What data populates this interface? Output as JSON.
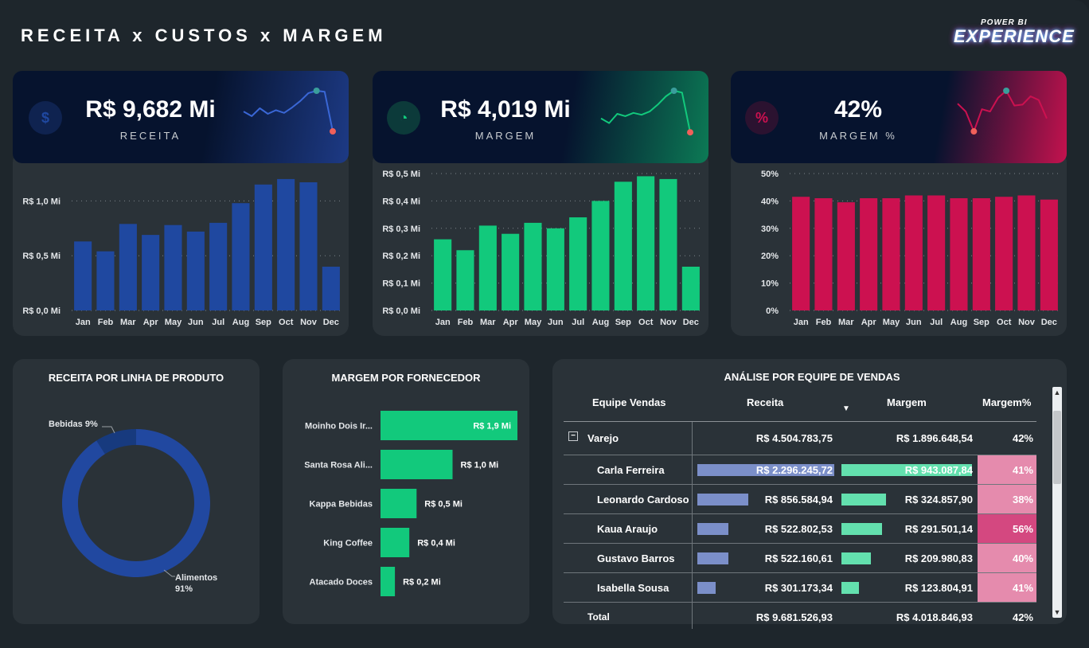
{
  "page": {
    "title": "RECEITA x CUSTOS x MARGEM",
    "logo_top": "POWER BI",
    "logo_main": "EXPERIENCE"
  },
  "colors": {
    "receita": "#1f48a0",
    "margem": "#12c97c",
    "margem_pct": "#cc1150",
    "table_receita_bar": "#7b8fc9",
    "table_margem_bar": "#63e0ae",
    "pct_light": "#e58bad",
    "pct_strong": "#d44880"
  },
  "kpis": [
    {
      "id": "receita",
      "value": "R$ 9,682 Mi",
      "label": "RECEITA",
      "icon": "money-bag-icon",
      "icon_glyph": "$",
      "line": [
        0.55,
        0.45,
        0.62,
        0.5,
        0.58,
        0.52,
        0.64,
        0.78,
        0.95,
        1.0,
        0.98,
        0.12
      ]
    },
    {
      "id": "margem",
      "value": "R$ 4,019 Mi",
      "label": "MARGEM",
      "icon": "pie-chart-icon",
      "icon_glyph": "◔",
      "line": [
        0.4,
        0.3,
        0.5,
        0.45,
        0.52,
        0.48,
        0.55,
        0.7,
        0.88,
        1.0,
        0.96,
        0.1
      ]
    },
    {
      "id": "margem_pct",
      "value": "42%",
      "label": "MARGEM %",
      "icon": "percent-icon",
      "icon_glyph": "%",
      "line": [
        0.72,
        0.55,
        0.12,
        0.6,
        0.55,
        0.85,
        1.0,
        0.68,
        0.7,
        0.88,
        0.8,
        0.4
      ]
    }
  ],
  "chart_data": [
    {
      "type": "bar",
      "title": "",
      "categories": [
        "Jan",
        "Feb",
        "Mar",
        "Apr",
        "May",
        "Jun",
        "Jul",
        "Aug",
        "Sep",
        "Oct",
        "Nov",
        "Dec"
      ],
      "values": [
        0.63,
        0.54,
        0.79,
        0.69,
        0.78,
        0.72,
        0.8,
        0.98,
        1.15,
        1.2,
        1.17,
        0.4
      ],
      "ylim": [
        0,
        1.25
      ],
      "yticks": [
        0,
        0.5,
        1.0
      ],
      "ytick_labels": [
        "R$ 0,0 Mi",
        "R$ 0,5 Mi",
        "R$ 1,0 Mi"
      ],
      "grid": true
    },
    {
      "type": "bar",
      "title": "",
      "categories": [
        "Jan",
        "Feb",
        "Mar",
        "Apr",
        "May",
        "Jun",
        "Jul",
        "Aug",
        "Sep",
        "Oct",
        "Nov",
        "Dec"
      ],
      "values": [
        0.26,
        0.22,
        0.31,
        0.28,
        0.32,
        0.3,
        0.34,
        0.4,
        0.47,
        0.49,
        0.48,
        0.16
      ],
      "ylim": [
        0,
        0.5
      ],
      "yticks": [
        0,
        0.1,
        0.2,
        0.3,
        0.4,
        0.5
      ],
      "ytick_labels": [
        "R$ 0,0 Mi",
        "R$ 0,1 Mi",
        "R$ 0,2 Mi",
        "R$ 0,3 Mi",
        "R$ 0,4 Mi",
        "R$ 0,5 Mi"
      ],
      "grid": true
    },
    {
      "type": "bar",
      "title": "",
      "categories": [
        "Jan",
        "Feb",
        "Mar",
        "Apr",
        "May",
        "Jun",
        "Jul",
        "Aug",
        "Sep",
        "Oct",
        "Nov",
        "Dec"
      ],
      "values": [
        41.5,
        41,
        39.5,
        41,
        41,
        42,
        42,
        41,
        41,
        41.5,
        42,
        40.5
      ],
      "ylim": [
        0,
        50
      ],
      "yticks": [
        0,
        10,
        20,
        30,
        40,
        50
      ],
      "ytick_labels": [
        "0%",
        "10%",
        "20%",
        "30%",
        "40%",
        "50%"
      ],
      "grid": true
    },
    {
      "type": "pie",
      "title": "RECEITA POR LINHA DE PRODUTO",
      "categories": [
        "Bebidas",
        "Alimentos"
      ],
      "values": [
        9,
        91
      ],
      "slice_labels": [
        "Bebidas 9%",
        "Alimentos",
        "91%"
      ]
    },
    {
      "type": "bar",
      "orientation": "horizontal",
      "title": "MARGEM POR FORNECEDOR",
      "categories": [
        "Moinho Dois Ir...",
        "Santa Rosa Ali...",
        "Kappa Bebidas",
        "King Coffee",
        "Atacado Doces"
      ],
      "values": [
        1.9,
        1.0,
        0.5,
        0.4,
        0.2
      ],
      "value_labels": [
        "R$ 1,9 Mi",
        "R$ 1,0 Mi",
        "R$ 0,5 Mi",
        "R$ 0,4 Mi",
        "R$ 0,2 Mi"
      ]
    },
    {
      "type": "table",
      "title": "ANÁLISE POR EQUIPE DE VENDAS",
      "columns": [
        "Equipe Vendas",
        "Receita",
        "Margem",
        "Margem%"
      ],
      "group": {
        "label": "Varejo",
        "receita": "R$ 4.504.783,75",
        "margem": "R$ 1.896.648,54",
        "pct": "42%"
      },
      "rows": [
        {
          "name": "Carla Ferreira",
          "receita": "R$ 2.296.245,72",
          "receita_v": 2296245.72,
          "margem": "R$ 943.087,84",
          "margem_v": 943087.84,
          "pct": "41%",
          "pct_v": 41
        },
        {
          "name": "Leonardo Cardoso",
          "receita": "R$ 856.584,94",
          "receita_v": 856584.94,
          "margem": "R$ 324.857,90",
          "margem_v": 324857.9,
          "pct": "38%",
          "pct_v": 38
        },
        {
          "name": "Kaua Araujo",
          "receita": "R$ 522.802,53",
          "receita_v": 522802.53,
          "margem": "R$ 291.501,14",
          "margem_v": 291501.14,
          "pct": "56%",
          "pct_v": 56
        },
        {
          "name": "Gustavo Barros",
          "receita": "R$ 522.160,61",
          "receita_v": 522160.61,
          "margem": "R$ 209.980,83",
          "margem_v": 209980.83,
          "pct": "40%",
          "pct_v": 40
        },
        {
          "name": "Isabella Sousa",
          "receita": "R$ 301.173,34",
          "receita_v": 301173.34,
          "margem": "R$ 123.804,91",
          "margem_v": 123804.91,
          "pct": "41%",
          "pct_v": 41
        }
      ],
      "total": {
        "label": "Total",
        "receita": "R$ 9.681.526,93",
        "margem": "R$ 4.018.846,93",
        "pct": "42%"
      },
      "sort_icon": "sort-down-icon",
      "collapse_icon": "minus-box-icon"
    }
  ]
}
